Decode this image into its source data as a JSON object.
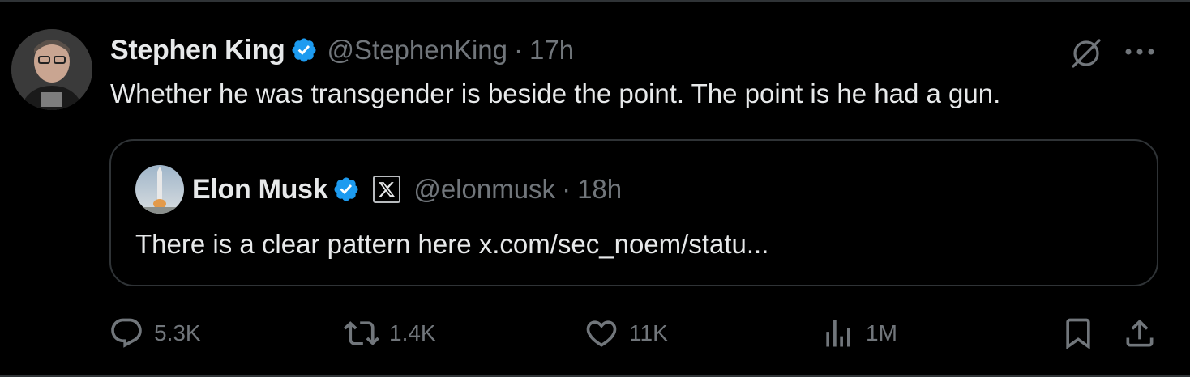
{
  "tweet": {
    "author": {
      "display_name": "Stephen King",
      "handle": "@StephenKing",
      "verified_color": "#1d9bf0"
    },
    "separator": "·",
    "time": "17h",
    "text": "Whether he was transgender is beside the point. The point is he had a gun.",
    "header_icons": [
      "grok-icon",
      "more-icon"
    ]
  },
  "quote": {
    "author": {
      "display_name": "Elon Musk",
      "handle": "@elonmusk",
      "affiliate_badge": "x-logo-icon"
    },
    "separator": "·",
    "time": "18h",
    "text": "There is a clear pattern here x.com/sec_noem/statu..."
  },
  "actions": {
    "replies": "5.3K",
    "reposts": "1.4K",
    "likes": "11K",
    "views": "1M",
    "icons": [
      "reply-icon",
      "repost-icon",
      "like-icon",
      "views-icon",
      "bookmark-icon",
      "share-icon"
    ]
  },
  "colors": {
    "background": "#000000",
    "text": "#e7e9ea",
    "secondary": "#71767b",
    "border": "#2f3336",
    "verified": "#1d9bf0"
  }
}
